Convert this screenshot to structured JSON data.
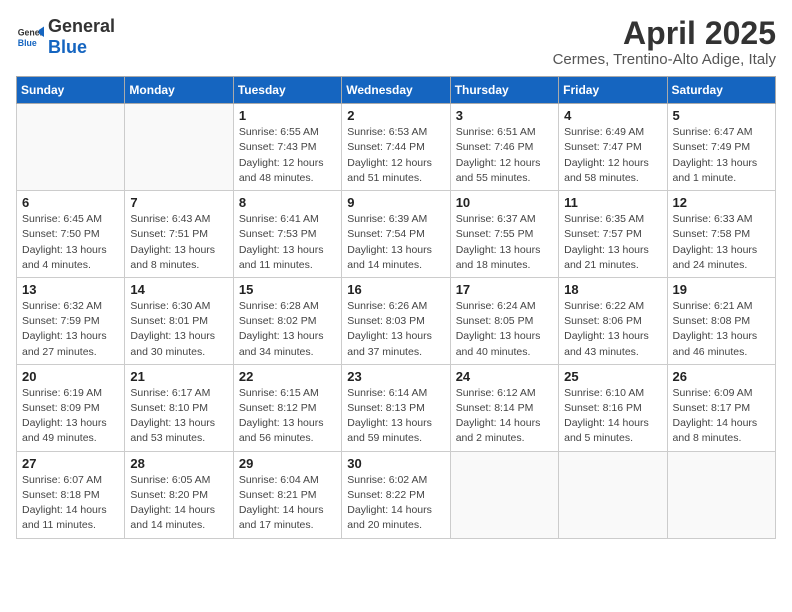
{
  "header": {
    "logo_general": "General",
    "logo_blue": "Blue",
    "month_title": "April 2025",
    "subtitle": "Cermes, Trentino-Alto Adige, Italy"
  },
  "days_of_week": [
    "Sunday",
    "Monday",
    "Tuesday",
    "Wednesday",
    "Thursday",
    "Friday",
    "Saturday"
  ],
  "weeks": [
    [
      {
        "day": "",
        "info": ""
      },
      {
        "day": "",
        "info": ""
      },
      {
        "day": "1",
        "info": "Sunrise: 6:55 AM\nSunset: 7:43 PM\nDaylight: 12 hours and 48 minutes."
      },
      {
        "day": "2",
        "info": "Sunrise: 6:53 AM\nSunset: 7:44 PM\nDaylight: 12 hours and 51 minutes."
      },
      {
        "day": "3",
        "info": "Sunrise: 6:51 AM\nSunset: 7:46 PM\nDaylight: 12 hours and 55 minutes."
      },
      {
        "day": "4",
        "info": "Sunrise: 6:49 AM\nSunset: 7:47 PM\nDaylight: 12 hours and 58 minutes."
      },
      {
        "day": "5",
        "info": "Sunrise: 6:47 AM\nSunset: 7:49 PM\nDaylight: 13 hours and 1 minute."
      }
    ],
    [
      {
        "day": "6",
        "info": "Sunrise: 6:45 AM\nSunset: 7:50 PM\nDaylight: 13 hours and 4 minutes."
      },
      {
        "day": "7",
        "info": "Sunrise: 6:43 AM\nSunset: 7:51 PM\nDaylight: 13 hours and 8 minutes."
      },
      {
        "day": "8",
        "info": "Sunrise: 6:41 AM\nSunset: 7:53 PM\nDaylight: 13 hours and 11 minutes."
      },
      {
        "day": "9",
        "info": "Sunrise: 6:39 AM\nSunset: 7:54 PM\nDaylight: 13 hours and 14 minutes."
      },
      {
        "day": "10",
        "info": "Sunrise: 6:37 AM\nSunset: 7:55 PM\nDaylight: 13 hours and 18 minutes."
      },
      {
        "day": "11",
        "info": "Sunrise: 6:35 AM\nSunset: 7:57 PM\nDaylight: 13 hours and 21 minutes."
      },
      {
        "day": "12",
        "info": "Sunrise: 6:33 AM\nSunset: 7:58 PM\nDaylight: 13 hours and 24 minutes."
      }
    ],
    [
      {
        "day": "13",
        "info": "Sunrise: 6:32 AM\nSunset: 7:59 PM\nDaylight: 13 hours and 27 minutes."
      },
      {
        "day": "14",
        "info": "Sunrise: 6:30 AM\nSunset: 8:01 PM\nDaylight: 13 hours and 30 minutes."
      },
      {
        "day": "15",
        "info": "Sunrise: 6:28 AM\nSunset: 8:02 PM\nDaylight: 13 hours and 34 minutes."
      },
      {
        "day": "16",
        "info": "Sunrise: 6:26 AM\nSunset: 8:03 PM\nDaylight: 13 hours and 37 minutes."
      },
      {
        "day": "17",
        "info": "Sunrise: 6:24 AM\nSunset: 8:05 PM\nDaylight: 13 hours and 40 minutes."
      },
      {
        "day": "18",
        "info": "Sunrise: 6:22 AM\nSunset: 8:06 PM\nDaylight: 13 hours and 43 minutes."
      },
      {
        "day": "19",
        "info": "Sunrise: 6:21 AM\nSunset: 8:08 PM\nDaylight: 13 hours and 46 minutes."
      }
    ],
    [
      {
        "day": "20",
        "info": "Sunrise: 6:19 AM\nSunset: 8:09 PM\nDaylight: 13 hours and 49 minutes."
      },
      {
        "day": "21",
        "info": "Sunrise: 6:17 AM\nSunset: 8:10 PM\nDaylight: 13 hours and 53 minutes."
      },
      {
        "day": "22",
        "info": "Sunrise: 6:15 AM\nSunset: 8:12 PM\nDaylight: 13 hours and 56 minutes."
      },
      {
        "day": "23",
        "info": "Sunrise: 6:14 AM\nSunset: 8:13 PM\nDaylight: 13 hours and 59 minutes."
      },
      {
        "day": "24",
        "info": "Sunrise: 6:12 AM\nSunset: 8:14 PM\nDaylight: 14 hours and 2 minutes."
      },
      {
        "day": "25",
        "info": "Sunrise: 6:10 AM\nSunset: 8:16 PM\nDaylight: 14 hours and 5 minutes."
      },
      {
        "day": "26",
        "info": "Sunrise: 6:09 AM\nSunset: 8:17 PM\nDaylight: 14 hours and 8 minutes."
      }
    ],
    [
      {
        "day": "27",
        "info": "Sunrise: 6:07 AM\nSunset: 8:18 PM\nDaylight: 14 hours and 11 minutes."
      },
      {
        "day": "28",
        "info": "Sunrise: 6:05 AM\nSunset: 8:20 PM\nDaylight: 14 hours and 14 minutes."
      },
      {
        "day": "29",
        "info": "Sunrise: 6:04 AM\nSunset: 8:21 PM\nDaylight: 14 hours and 17 minutes."
      },
      {
        "day": "30",
        "info": "Sunrise: 6:02 AM\nSunset: 8:22 PM\nDaylight: 14 hours and 20 minutes."
      },
      {
        "day": "",
        "info": ""
      },
      {
        "day": "",
        "info": ""
      },
      {
        "day": "",
        "info": ""
      }
    ]
  ]
}
